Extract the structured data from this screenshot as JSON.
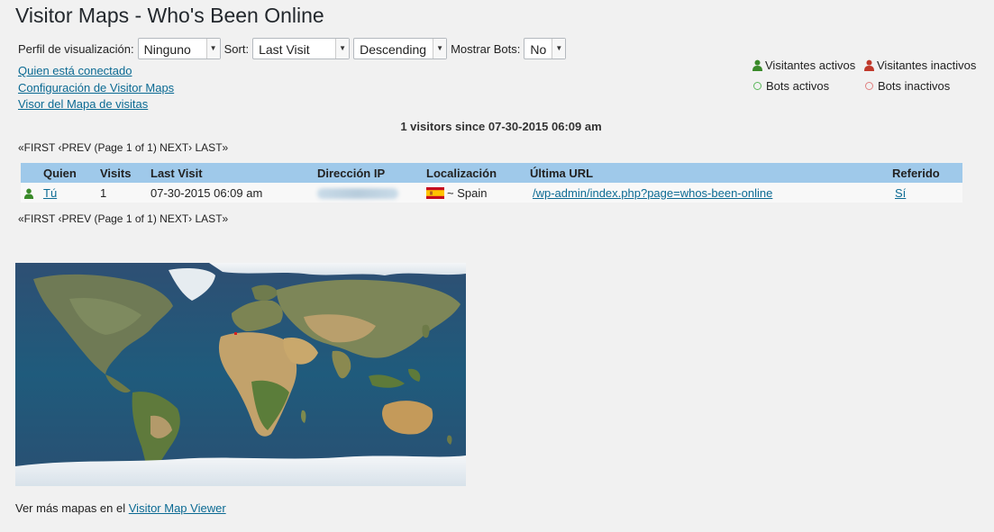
{
  "page": {
    "title": "Visitor Maps - Who's Been Online"
  },
  "filters": {
    "profile_label": "Perfil de visualización:",
    "profile_value": "Ninguno",
    "sort_label": "Sort:",
    "sort_value": "Last Visit",
    "order_value": "Descending",
    "bots_label": "Mostrar Bots:",
    "bots_value": "No"
  },
  "links": {
    "who_online": "Quien está conectado",
    "config": "Configuración de Visitor Maps",
    "map_viewer": "Visor del Mapa de visitas"
  },
  "legend": {
    "active_visitors": "Visitantes activos",
    "inactive_visitors": "Visitantes inactivos",
    "active_bots": "Bots activos",
    "inactive_bots": "Bots inactivos"
  },
  "summary": "1 visitors since 07-30-2015 06:09 am",
  "pager": "«FIRST ‹PREV (Page 1 of 1) NEXT› LAST»",
  "table": {
    "headers": {
      "who": "Quien",
      "visits": "Visits",
      "last_visit": "Last Visit",
      "ip": "Dirección IP",
      "location": "Localización",
      "last_url": "Última URL",
      "referer": "Referido"
    },
    "rows": [
      {
        "who": "Tú",
        "visits": "1",
        "last_visit": "07-30-2015 06:09 am",
        "location": "~ Spain",
        "last_url": "/wp-admin/index.php?page=whos-been-online",
        "referer": "Sí"
      }
    ]
  },
  "footer": {
    "text": "Ver más mapas en el",
    "link": "Visitor Map Viewer"
  },
  "colors": {
    "header_bg": "#9fc9ea",
    "link": "#0b6a93",
    "active_green": "#3a8a2a",
    "inactive_red": "#c0392b"
  },
  "icons": [
    "active-visitor-icon",
    "inactive-visitor-icon",
    "active-bot-icon",
    "inactive-bot-icon",
    "spain-flag-icon",
    "select-arrow-icon"
  ]
}
